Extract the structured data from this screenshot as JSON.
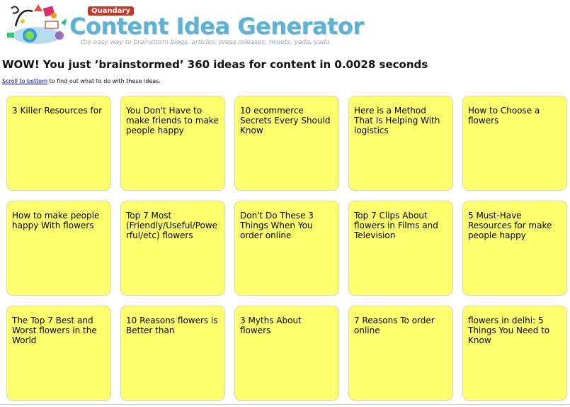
{
  "header": {
    "badge": "Quandary",
    "title": "Content Idea Generator",
    "tagline": "the easy way to brainstorm blogs, articles, press releases, tweets, yada, yada"
  },
  "headline": "WOW! You just ’brainstormed’ 360 ideas for content in 0.0028 seconds",
  "hint": {
    "link": "Scroll to bottom",
    "text": " to find out what to do with these ideas."
  },
  "ideas": [
    "3 Killer Resources for",
    "You Don't Have to make friends to make people happy",
    "10 ecommerce Secrets Every Should Know",
    "Here is a Method That Is Helping With logistics",
    "How to Choose a flowers",
    "How to make people happy With flowers",
    "Top 7 Most (Friendly/Useful/Powerful/etc) flowers",
    "Don't Do These 3 Things When You order online",
    "Top 7 Clips About flowers in Films and Television",
    "5 Must-Have Resources for make people happy",
    "The Top 7 Best and Worst flowers in the World",
    "10 Reasons flowers is Better than",
    "3 Myths About flowers",
    "7 Reasons To order online",
    "flowers in delhi: 5 Things You Need to Know"
  ],
  "colors": {
    "card": "#ffff6e",
    "title": "#5fb2d4",
    "badge": "#c0392b"
  }
}
